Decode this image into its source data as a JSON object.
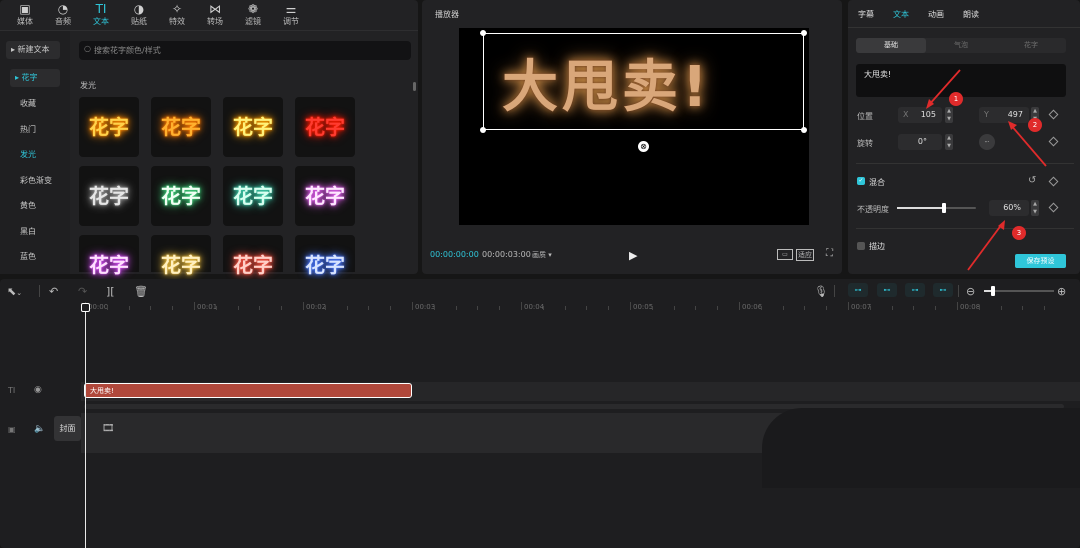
{
  "toolbar": {
    "items": [
      {
        "label": "媒体",
        "icon": "media-icon",
        "glyph": "▣"
      },
      {
        "label": "音频",
        "icon": "audio-icon",
        "glyph": "◔"
      },
      {
        "label": "文本",
        "icon": "text-icon",
        "glyph": "TI"
      },
      {
        "label": "贴纸",
        "icon": "sticker-icon",
        "glyph": "◑"
      },
      {
        "label": "特效",
        "icon": "effects-icon",
        "glyph": "✧"
      },
      {
        "label": "转场",
        "icon": "transition-icon",
        "glyph": "⋈"
      },
      {
        "label": "滤镜",
        "icon": "filter-icon",
        "glyph": "❁"
      },
      {
        "label": "调节",
        "icon": "adjust-icon",
        "glyph": "⚌"
      }
    ],
    "active_index": 2
  },
  "left_menu": {
    "new_text": "▸ 新建文本",
    "items": [
      "▸ 花字",
      "收藏",
      "热门",
      "发光",
      "彩色渐变",
      "黄色",
      "黑白",
      "蓝色"
    ],
    "selected_index": 0,
    "highlight_index": 3
  },
  "search": {
    "placeholder": "搜索花字颜色/样式"
  },
  "section_title": "发光",
  "tile_text": "花字",
  "tiles": [
    {
      "color": "#ffd24a",
      "glow": "#ff8a00"
    },
    {
      "color": "#ffb02e",
      "glow": "#ff7a00"
    },
    {
      "color": "#fff27a",
      "glow": "#ff9d00"
    },
    {
      "color": "#ff3b2f",
      "glow": "#ff1a00"
    },
    {
      "color": "#e6e6e6",
      "glow": "#9a9a9a"
    },
    {
      "color": "#f0fff4",
      "glow": "#41d67e"
    },
    {
      "color": "#d8fff0",
      "glow": "#3fd2b0"
    },
    {
      "color": "#ffe6ff",
      "glow": "#e35ff0"
    },
    {
      "color": "#ffe0ff",
      "glow": "#d24df2"
    },
    {
      "color": "#fff0c0",
      "glow": "#f0c040"
    },
    {
      "color": "#ffd0c8",
      "glow": "#ff5544"
    },
    {
      "color": "#d8e4ff",
      "glow": "#4a78ff"
    }
  ],
  "player": {
    "title": "播放器",
    "canvas_text": "大甩卖!",
    "current_time": "00:00:00:00",
    "total_time": "00:00:03:00",
    "quality": "画质 ▾",
    "btn_ratio": "比例",
    "btn_original": "适应"
  },
  "inspector": {
    "tabs": [
      "字幕",
      "文本",
      "动画",
      "朗读"
    ],
    "active_tab": 1,
    "subtabs": [
      "基础",
      "气泡",
      "花字"
    ],
    "text_value": "大甩卖!",
    "position_label": "位置",
    "x_label": "X",
    "x_value": "105",
    "y_label": "Y",
    "y_value": "497",
    "rotate_label": "旋转",
    "rotate_value": "0°",
    "blend_label": "混合",
    "opacity_label": "不透明度",
    "opacity_value": "60%",
    "opacity_level": 0.6,
    "shadow_label": "描边",
    "save_preset": "保存预设",
    "badges": [
      "1",
      "2",
      "3"
    ]
  },
  "timeline": {
    "ticks": [
      "00:00",
      "00:01",
      "00:02",
      "00:03",
      "00:04",
      "00:05",
      "00:06",
      "00:07",
      "00:08"
    ],
    "clip_label": "大甩卖!",
    "cover_label": "封面",
    "accent": "#2fc6d9",
    "clip_color": "#b0483b"
  }
}
